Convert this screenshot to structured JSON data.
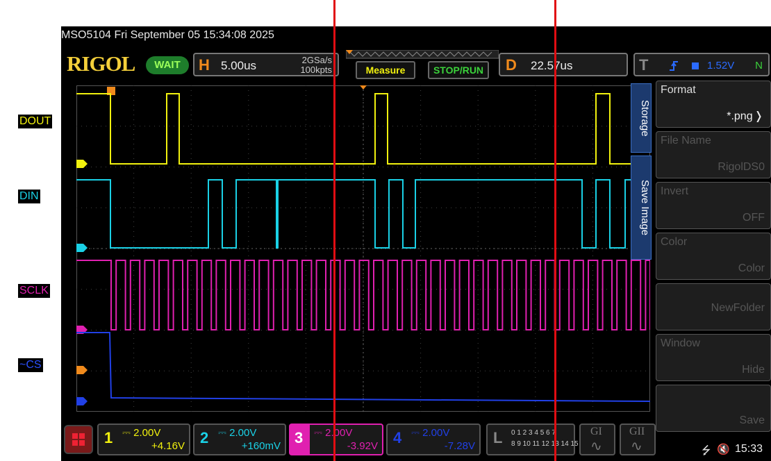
{
  "annotations": {
    "dout": "DOUT",
    "din": "DIN",
    "sclk": "SCLK",
    "cs": "~CS"
  },
  "header": {
    "model_and_date": "MSO5104  Fri September 05 15:34:08 2025"
  },
  "logo": "RIGOL",
  "status": "WAIT",
  "horizontal": {
    "letter": "H",
    "timebase": "5.00us",
    "sample_rate": "2GSa/s",
    "memory_depth": "100kpts"
  },
  "buttons": {
    "measure": "Measure",
    "stop_run": "STOP/RUN"
  },
  "delay": {
    "letter": "D",
    "value": "22.57us"
  },
  "trigger": {
    "letter": "T",
    "level": "1.52V",
    "mode": "N"
  },
  "menu": {
    "tabs": [
      "Storage",
      "Save Image"
    ],
    "items": [
      {
        "label": "Format",
        "value": "*.png"
      },
      {
        "label": "File Name",
        "value": "RigolDS0"
      },
      {
        "label": "Invert",
        "value": "OFF"
      },
      {
        "label": "Color",
        "value": "Color"
      },
      {
        "label": "",
        "value": "NewFolder"
      },
      {
        "label": "Window",
        "value": "Hide"
      },
      {
        "label": "",
        "value": "Save"
      }
    ]
  },
  "channels": [
    {
      "num": "1",
      "scale": "2.00V",
      "offset": "+4.16V",
      "color": "#f2f20e"
    },
    {
      "num": "2",
      "scale": "2.00V",
      "offset": "+160mV",
      "color": "#1ad1e6"
    },
    {
      "num": "3",
      "scale": "2.00V",
      "offset": "-3.92V",
      "color": "#e020b0"
    },
    {
      "num": "4",
      "scale": "2.00V",
      "offset": "-7.28V",
      "color": "#2140e6"
    }
  ],
  "logic": {
    "letter": "L",
    "bits_top": "0 1 2 3 4 5 6 7",
    "bits_bottom": "8 9 10 11 12 13 14 15"
  },
  "generators": [
    "GI",
    "GII"
  ],
  "status_bar": {
    "time": "15:33"
  },
  "colors": {
    "ch1": "#f2f20e",
    "ch2": "#1ad1e6",
    "ch3": "#e020b0",
    "ch4": "#2140e6",
    "trigger_orange": "#f08a1c",
    "cursor_red": "#e10d12"
  },
  "icons": [
    "rigol-menu-icon",
    "usb-icon",
    "speaker-mute-icon",
    "trigger-edge-icon"
  ]
}
